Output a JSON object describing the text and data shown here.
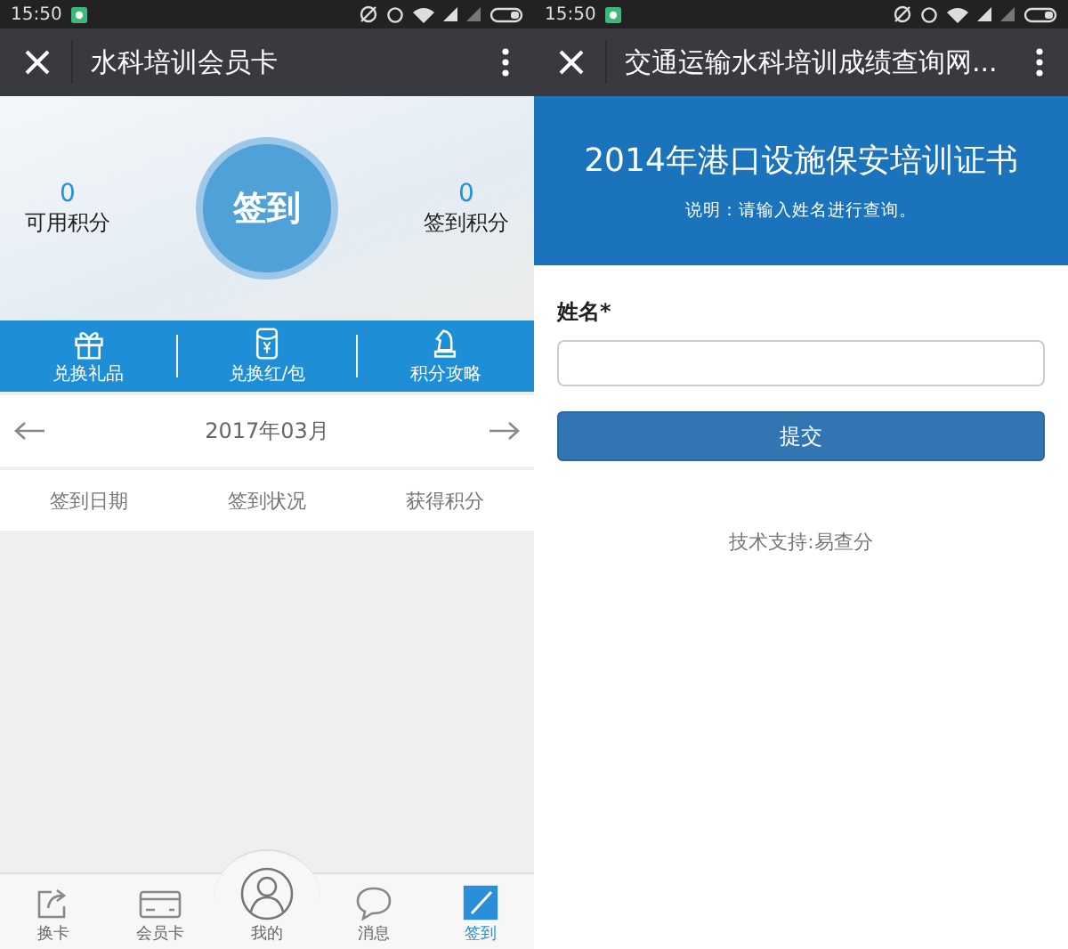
{
  "left_phone": {
    "status_bar": {
      "time": "15:50"
    },
    "title_bar": {
      "title": "水科培训会员卡"
    },
    "points": {
      "available": {
        "value": "0",
        "label": "可用积分"
      },
      "checkin_button": "签到",
      "checkin_points": {
        "value": "0",
        "label": "签到积分"
      }
    },
    "actions": [
      {
        "label": "兑换礼品",
        "kind": "gift"
      },
      {
        "label": "兑换红/包",
        "kind": "envelope"
      },
      {
        "label": "积分攻略",
        "kind": "chess"
      }
    ],
    "month_nav": {
      "month": "2017年03月"
    },
    "table": {
      "columns": [
        "签到日期",
        "签到状况",
        "获得积分"
      ]
    },
    "tab_bar": [
      {
        "label": "换卡",
        "kind": "share",
        "selected": false
      },
      {
        "label": "会员卡",
        "kind": "card",
        "selected": false
      },
      {
        "label": "我的",
        "kind": "person",
        "selected": false
      },
      {
        "label": "消息",
        "kind": "bubble",
        "selected": false
      },
      {
        "label": "签到",
        "kind": "pen",
        "selected": true
      }
    ]
  },
  "right_phone": {
    "status_bar": {
      "time": "15:50"
    },
    "title_bar": {
      "title": "交通运输水科培训成绩查询网..."
    },
    "header": {
      "title": "2014年港口设施保安培训证书",
      "note": "说明：请输入姓名进行查询。"
    },
    "form": {
      "field_label": "姓名*",
      "submit": "提交"
    },
    "footer": "技术支持:易查分"
  }
}
